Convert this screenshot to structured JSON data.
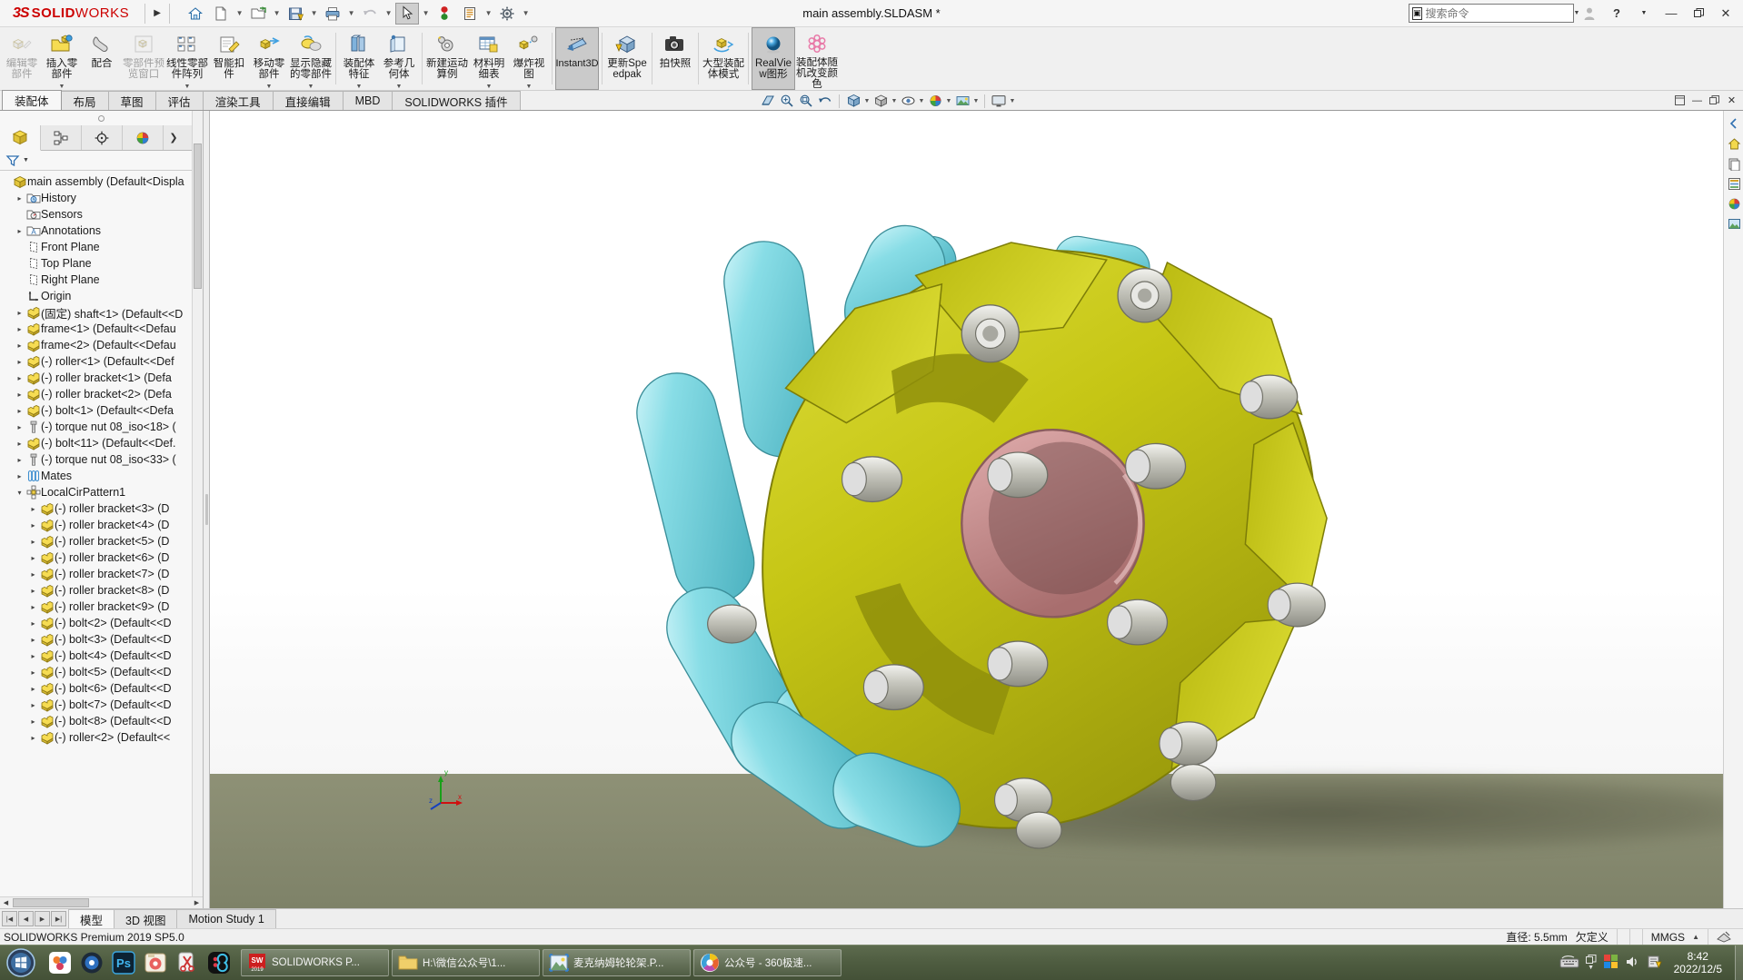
{
  "titlebar": {
    "brand_ds": "3S",
    "brand_bold": "SOLID",
    "brand_light": "WORKS",
    "document_title": "main assembly.SLDASM *",
    "search_placeholder": "搜索命令",
    "icons": [
      "home-icon",
      "new-document-icon",
      "open-folder-icon",
      "save-icon",
      "print-icon",
      "undo-icon",
      "select-cursor-icon",
      "rebuild-icon",
      "options-gear-icon",
      "display-icon"
    ]
  },
  "ribbon": {
    "buttons": [
      {
        "label": "编辑零部件",
        "icon": "edit-component-icon",
        "disabled": true,
        "selected": false,
        "caret": false
      },
      {
        "label": "插入零部件",
        "icon": "insert-component-icon",
        "disabled": false,
        "selected": false,
        "caret": true
      },
      {
        "label": "配合",
        "icon": "mate-icon",
        "disabled": false,
        "selected": false,
        "caret": false
      },
      {
        "label": "零部件预览窗口",
        "icon": "component-preview-icon",
        "disabled": true,
        "selected": false,
        "caret": false
      },
      {
        "label": "线性零部件阵列",
        "icon": "linear-pattern-icon",
        "disabled": false,
        "selected": false,
        "caret": true
      },
      {
        "label": "智能扣件",
        "icon": "smart-fastener-icon",
        "disabled": false,
        "selected": false,
        "caret": false
      },
      {
        "label": "移动零部件",
        "icon": "move-component-icon",
        "disabled": false,
        "selected": false,
        "caret": true
      },
      {
        "label": "显示隐藏的零部件",
        "icon": "show-hidden-components-icon",
        "disabled": false,
        "selected": false,
        "caret": true
      },
      {
        "label": "装配体特征",
        "icon": "assembly-feature-icon",
        "disabled": false,
        "selected": false,
        "caret": true
      },
      {
        "label": "参考几何体",
        "icon": "reference-geometry-icon",
        "disabled": false,
        "selected": false,
        "caret": true
      },
      {
        "label": "新建运动算例",
        "icon": "new-motion-study-icon",
        "disabled": false,
        "selected": false,
        "caret": false
      },
      {
        "label": "材料明细表",
        "icon": "bill-of-materials-icon",
        "disabled": false,
        "selected": false,
        "caret": true
      },
      {
        "label": "爆炸视图",
        "icon": "exploded-view-icon",
        "disabled": false,
        "selected": false,
        "caret": true
      },
      {
        "label": "Instant3D",
        "icon": "instant3d-icon",
        "disabled": false,
        "selected": true,
        "caret": false,
        "english": true
      },
      {
        "label": "更新Speedpak",
        "icon": "update-speedpak-icon",
        "disabled": false,
        "selected": false,
        "caret": false,
        "english": false
      },
      {
        "label": "拍快照",
        "icon": "snapshot-icon",
        "disabled": false,
        "selected": false,
        "caret": false
      },
      {
        "label": "大型装配体模式",
        "icon": "large-assembly-mode-icon",
        "disabled": false,
        "selected": false,
        "caret": false
      },
      {
        "label": "RealView图形",
        "icon": "realview-graphics-icon",
        "disabled": false,
        "selected": true,
        "caret": false
      },
      {
        "label": "装配体随机改变颜色",
        "icon": "random-color-icon",
        "disabled": false,
        "selected": false,
        "caret": false
      }
    ]
  },
  "tabs": {
    "items": [
      "装配体",
      "布局",
      "草图",
      "评估",
      "渲染工具",
      "直接编辑",
      "MBD",
      "SOLIDWORKS 插件"
    ],
    "active": "装配体",
    "view_tools": [
      "section-view-icon",
      "zoom-to-fit-icon",
      "zoom-area-icon",
      "previous-view-icon",
      "view-orientation-icon",
      "display-style-icon",
      "hide-show-icon",
      "edit-appearance-icon",
      "apply-scene-icon",
      "view-settings-icon"
    ],
    "window_controls": [
      "minimize-icon",
      "restore-icon",
      "close-icon"
    ]
  },
  "feature_manager": {
    "tabs": [
      "feature-tree-tab",
      "property-manager-tab",
      "configuration-manager-tab",
      "display-manager-tab"
    ],
    "active_tab_index": 0,
    "filter_icon": "filter-icon",
    "tree": [
      {
        "label": "main assembly  (Default<Displa",
        "icon": "assembly-icon",
        "indent": 0,
        "expand": "",
        "root": true
      },
      {
        "label": "History",
        "icon": "history-folder-icon",
        "indent": 1,
        "expand": "▸"
      },
      {
        "label": "Sensors",
        "icon": "sensors-folder-icon",
        "indent": 1,
        "expand": ""
      },
      {
        "label": "Annotations",
        "icon": "annotations-folder-icon",
        "indent": 1,
        "expand": "▸"
      },
      {
        "label": "Front Plane",
        "icon": "plane-icon",
        "indent": 1,
        "expand": ""
      },
      {
        "label": "Top Plane",
        "icon": "plane-icon",
        "indent": 1,
        "expand": ""
      },
      {
        "label": "Right Plane",
        "icon": "plane-icon",
        "indent": 1,
        "expand": ""
      },
      {
        "label": "Origin",
        "icon": "origin-icon",
        "indent": 1,
        "expand": ""
      },
      {
        "label": "(固定) shaft<1> (Default<<D",
        "icon": "part-icon",
        "indent": 1,
        "expand": "▸"
      },
      {
        "label": "frame<1> (Default<<Defau",
        "icon": "part-icon",
        "indent": 1,
        "expand": "▸"
      },
      {
        "label": "frame<2> (Default<<Defau",
        "icon": "part-icon",
        "indent": 1,
        "expand": "▸"
      },
      {
        "label": "(-) roller<1> (Default<<Def",
        "icon": "part-icon",
        "indent": 1,
        "expand": "▸"
      },
      {
        "label": "(-) roller bracket<1> (Defa",
        "icon": "part-icon",
        "indent": 1,
        "expand": "▸"
      },
      {
        "label": "(-) roller bracket<2> (Defa",
        "icon": "part-icon",
        "indent": 1,
        "expand": "▸"
      },
      {
        "label": "(-) bolt<1> (Default<<Defa",
        "icon": "part-icon",
        "indent": 1,
        "expand": "▸"
      },
      {
        "label": "(-) torque nut 08_iso<18> (",
        "icon": "fastener-icon",
        "indent": 1,
        "expand": "▸"
      },
      {
        "label": "(-) bolt<11> (Default<<Def.",
        "icon": "part-icon",
        "indent": 1,
        "expand": "▸"
      },
      {
        "label": "(-) torque nut 08_iso<33> (",
        "icon": "fastener-icon",
        "indent": 1,
        "expand": "▸"
      },
      {
        "label": "Mates",
        "icon": "mates-icon",
        "indent": 1,
        "expand": "▸"
      },
      {
        "label": "LocalCirPattern1",
        "icon": "circular-pattern-icon",
        "indent": 1,
        "expand": "▾"
      },
      {
        "label": "(-) roller bracket<3> (D",
        "icon": "part-icon",
        "indent": 2,
        "expand": "▸"
      },
      {
        "label": "(-) roller bracket<4> (D",
        "icon": "part-icon",
        "indent": 2,
        "expand": "▸"
      },
      {
        "label": "(-) roller bracket<5> (D",
        "icon": "part-icon",
        "indent": 2,
        "expand": "▸"
      },
      {
        "label": "(-) roller bracket<6> (D",
        "icon": "part-icon",
        "indent": 2,
        "expand": "▸"
      },
      {
        "label": "(-) roller bracket<7> (D",
        "icon": "part-icon",
        "indent": 2,
        "expand": "▸"
      },
      {
        "label": "(-) roller bracket<8> (D",
        "icon": "part-icon",
        "indent": 2,
        "expand": "▸"
      },
      {
        "label": "(-) roller bracket<9> (D",
        "icon": "part-icon",
        "indent": 2,
        "expand": "▸"
      },
      {
        "label": "(-) bolt<2> (Default<<D",
        "icon": "part-icon",
        "indent": 2,
        "expand": "▸"
      },
      {
        "label": "(-) bolt<3> (Default<<D",
        "icon": "part-icon",
        "indent": 2,
        "expand": "▸"
      },
      {
        "label": "(-) bolt<4> (Default<<D",
        "icon": "part-icon",
        "indent": 2,
        "expand": "▸"
      },
      {
        "label": "(-) bolt<5> (Default<<D",
        "icon": "part-icon",
        "indent": 2,
        "expand": "▸"
      },
      {
        "label": "(-) bolt<6> (Default<<D",
        "icon": "part-icon",
        "indent": 2,
        "expand": "▸"
      },
      {
        "label": "(-) bolt<7> (Default<<D",
        "icon": "part-icon",
        "indent": 2,
        "expand": "▸"
      },
      {
        "label": "(-) bolt<8> (Default<<D",
        "icon": "part-icon",
        "indent": 2,
        "expand": "▸"
      },
      {
        "label": "(-) roller<2> (Default<<",
        "icon": "part-icon",
        "indent": 2,
        "expand": "▸"
      }
    ]
  },
  "graphics": {
    "model_name": "mecanum-wheel-assembly",
    "triad_labels": {
      "x": "x",
      "y": "y",
      "z": "z"
    },
    "right_toolbar": [
      "view-orientation-icon",
      "appearances-icon",
      "scenes-icon",
      "decals-icon",
      "lights-icon",
      "custom-icon",
      "display-pane-icon"
    ],
    "colors": {
      "body_yellow": "#c8c818",
      "roller_cyan": "#7fd9e0",
      "hub_pink": "#c98a8a",
      "bolt_steel": "#c9c9c2",
      "floor_green": "#878b70"
    }
  },
  "document_tabs": {
    "items": [
      "模型",
      "3D 视图",
      "Motion Study 1"
    ],
    "active": "模型",
    "nav_buttons": [
      "first-icon",
      "previous-icon",
      "next-icon",
      "last-icon"
    ]
  },
  "status_bar": {
    "version": "SOLIDWORKS Premium 2019 SP5.0",
    "diameter": "直径: 5.5mm",
    "state": "欠定义",
    "units": "MMGS",
    "units_caret": "▲",
    "edit_icon": "editing-part-icon"
  },
  "taskbar": {
    "start_icon": "windows-start-orb",
    "quick_launch": [
      "sogou-icon",
      "media-player-icon",
      "photoshop-icon",
      "image-viewer-icon",
      "snip-icon",
      "qq-icon"
    ],
    "tasks": [
      {
        "label": "SOLIDWORKS P...",
        "icon": "solidworks-taskbar-icon"
      },
      {
        "label": "H:\\微信公众号\\1...",
        "icon": "folder-icon"
      },
      {
        "label": "麦克纳姆轮轮架.P...",
        "icon": "image-file-icon"
      },
      {
        "label": "公众号 - 360极速...",
        "icon": "browser-icon"
      }
    ],
    "tray": [
      "keyboard-icon",
      "tray-expand-icon",
      "windows-security-icon",
      "volume-icon",
      "action-center-icon"
    ],
    "clock_time": "8:42",
    "clock_date": "2022/12/5"
  }
}
